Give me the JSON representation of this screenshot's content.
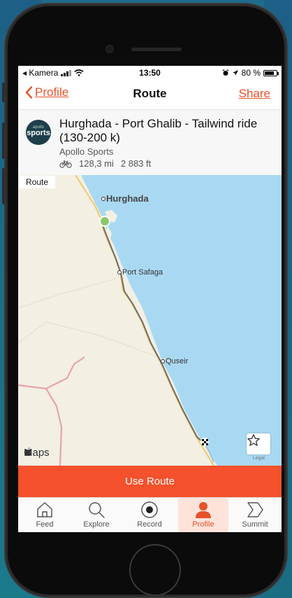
{
  "status_bar": {
    "carrier": "◂ Kamera",
    "time": "13:50",
    "battery": "80 %",
    "battery_level": 0.8
  },
  "nav": {
    "back_label": "Profile",
    "title": "Route",
    "share_label": "Share"
  },
  "route": {
    "logo_small": "apollo",
    "logo_large": "sports",
    "title": "Hurghada - Port Ghalib - Tailwind ride (130-200 k)",
    "owner": "Apollo  Sports",
    "distance": "128,3 mi",
    "elevation": "2 883 ft"
  },
  "map": {
    "tag": "Route",
    "places": {
      "hurghada": "Hurghada",
      "safaga": "Port Safaga",
      "quseir": "Quseir"
    },
    "attribution": "Maps",
    "legal": "Legal",
    "colors": {
      "sea": "#a9d9f2",
      "land": "#f3efe3",
      "route": "#6e6e6e",
      "road": "#f2c86a",
      "border": "#e7a3ad",
      "start": "#8cc86a"
    }
  },
  "action": {
    "use_route_label": "Use Route",
    "color": "#f4512c"
  },
  "tabs": [
    {
      "label": "Feed",
      "icon": "home-icon"
    },
    {
      "label": "Explore",
      "icon": "search-icon"
    },
    {
      "label": "Record",
      "icon": "record-icon"
    },
    {
      "label": "Profile",
      "icon": "profile-icon",
      "active": true
    },
    {
      "label": "Summit",
      "icon": "summit-icon"
    }
  ]
}
